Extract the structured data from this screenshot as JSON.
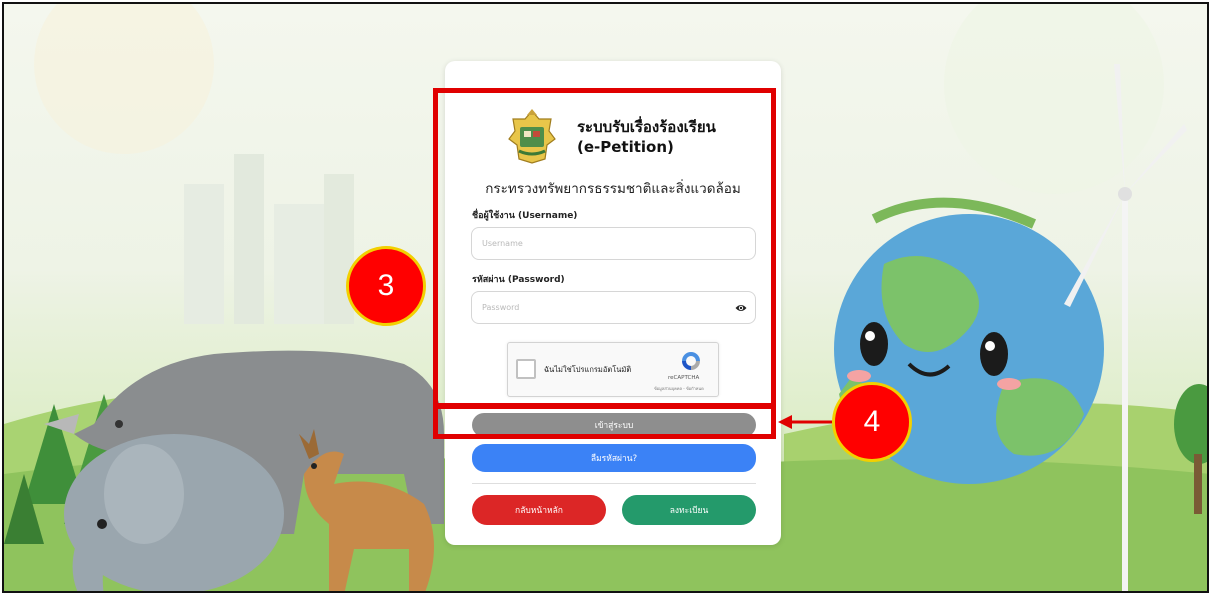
{
  "header": {
    "title_line1": "ระบบรับเรื่องร้องเรียน",
    "title_line2": "(e-Petition)",
    "subtitle": "กระทรวงทรัพยากรธรรมชาติและสิ่งแวดล้อม"
  },
  "form": {
    "username_label": "ชื่อผู้ใช้งาน (Username)",
    "username_placeholder": "Username",
    "password_label": "รหัสผ่าน (Password)",
    "password_placeholder": "Password"
  },
  "recaptcha": {
    "label": "ฉันไม่ใช่โปรแกรมอัตโนมัติ",
    "brand": "reCAPTCHA",
    "links": "ข้อมูลส่วนบุคคล - ข้อกำหนด"
  },
  "buttons": {
    "login": "เข้าสู่ระบบ",
    "forgot_password": "ลืมรหัสผ่าน?",
    "home": "กลับหน้าหลัก",
    "register": "ลงทะเบียน"
  },
  "callouts": {
    "step3": "3",
    "step4": "4"
  },
  "colors": {
    "login": "#8e8e8e",
    "forgot_password": "#3b82f6",
    "home": "#dc2626",
    "register": "#249a6b",
    "highlight": "#e00000",
    "callout_fill": "#ff0000",
    "callout_border": "#f2d000"
  }
}
